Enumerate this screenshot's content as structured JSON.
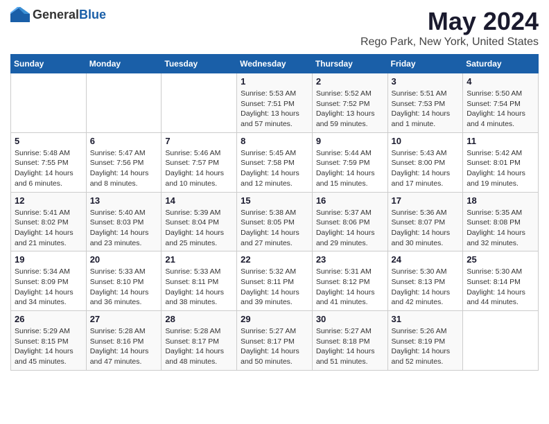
{
  "header": {
    "logo_general": "General",
    "logo_blue": "Blue",
    "title": "May 2024",
    "subtitle": "Rego Park, New York, United States"
  },
  "weekdays": [
    "Sunday",
    "Monday",
    "Tuesday",
    "Wednesday",
    "Thursday",
    "Friday",
    "Saturday"
  ],
  "weeks": [
    [
      {
        "day": "",
        "info": ""
      },
      {
        "day": "",
        "info": ""
      },
      {
        "day": "",
        "info": ""
      },
      {
        "day": "1",
        "info": "Sunrise: 5:53 AM\nSunset: 7:51 PM\nDaylight: 13 hours\nand 57 minutes."
      },
      {
        "day": "2",
        "info": "Sunrise: 5:52 AM\nSunset: 7:52 PM\nDaylight: 13 hours\nand 59 minutes."
      },
      {
        "day": "3",
        "info": "Sunrise: 5:51 AM\nSunset: 7:53 PM\nDaylight: 14 hours\nand 1 minute."
      },
      {
        "day": "4",
        "info": "Sunrise: 5:50 AM\nSunset: 7:54 PM\nDaylight: 14 hours\nand 4 minutes."
      }
    ],
    [
      {
        "day": "5",
        "info": "Sunrise: 5:48 AM\nSunset: 7:55 PM\nDaylight: 14 hours\nand 6 minutes."
      },
      {
        "day": "6",
        "info": "Sunrise: 5:47 AM\nSunset: 7:56 PM\nDaylight: 14 hours\nand 8 minutes."
      },
      {
        "day": "7",
        "info": "Sunrise: 5:46 AM\nSunset: 7:57 PM\nDaylight: 14 hours\nand 10 minutes."
      },
      {
        "day": "8",
        "info": "Sunrise: 5:45 AM\nSunset: 7:58 PM\nDaylight: 14 hours\nand 12 minutes."
      },
      {
        "day": "9",
        "info": "Sunrise: 5:44 AM\nSunset: 7:59 PM\nDaylight: 14 hours\nand 15 minutes."
      },
      {
        "day": "10",
        "info": "Sunrise: 5:43 AM\nSunset: 8:00 PM\nDaylight: 14 hours\nand 17 minutes."
      },
      {
        "day": "11",
        "info": "Sunrise: 5:42 AM\nSunset: 8:01 PM\nDaylight: 14 hours\nand 19 minutes."
      }
    ],
    [
      {
        "day": "12",
        "info": "Sunrise: 5:41 AM\nSunset: 8:02 PM\nDaylight: 14 hours\nand 21 minutes."
      },
      {
        "day": "13",
        "info": "Sunrise: 5:40 AM\nSunset: 8:03 PM\nDaylight: 14 hours\nand 23 minutes."
      },
      {
        "day": "14",
        "info": "Sunrise: 5:39 AM\nSunset: 8:04 PM\nDaylight: 14 hours\nand 25 minutes."
      },
      {
        "day": "15",
        "info": "Sunrise: 5:38 AM\nSunset: 8:05 PM\nDaylight: 14 hours\nand 27 minutes."
      },
      {
        "day": "16",
        "info": "Sunrise: 5:37 AM\nSunset: 8:06 PM\nDaylight: 14 hours\nand 29 minutes."
      },
      {
        "day": "17",
        "info": "Sunrise: 5:36 AM\nSunset: 8:07 PM\nDaylight: 14 hours\nand 30 minutes."
      },
      {
        "day": "18",
        "info": "Sunrise: 5:35 AM\nSunset: 8:08 PM\nDaylight: 14 hours\nand 32 minutes."
      }
    ],
    [
      {
        "day": "19",
        "info": "Sunrise: 5:34 AM\nSunset: 8:09 PM\nDaylight: 14 hours\nand 34 minutes."
      },
      {
        "day": "20",
        "info": "Sunrise: 5:33 AM\nSunset: 8:10 PM\nDaylight: 14 hours\nand 36 minutes."
      },
      {
        "day": "21",
        "info": "Sunrise: 5:33 AM\nSunset: 8:11 PM\nDaylight: 14 hours\nand 38 minutes."
      },
      {
        "day": "22",
        "info": "Sunrise: 5:32 AM\nSunset: 8:11 PM\nDaylight: 14 hours\nand 39 minutes."
      },
      {
        "day": "23",
        "info": "Sunrise: 5:31 AM\nSunset: 8:12 PM\nDaylight: 14 hours\nand 41 minutes."
      },
      {
        "day": "24",
        "info": "Sunrise: 5:30 AM\nSunset: 8:13 PM\nDaylight: 14 hours\nand 42 minutes."
      },
      {
        "day": "25",
        "info": "Sunrise: 5:30 AM\nSunset: 8:14 PM\nDaylight: 14 hours\nand 44 minutes."
      }
    ],
    [
      {
        "day": "26",
        "info": "Sunrise: 5:29 AM\nSunset: 8:15 PM\nDaylight: 14 hours\nand 45 minutes."
      },
      {
        "day": "27",
        "info": "Sunrise: 5:28 AM\nSunset: 8:16 PM\nDaylight: 14 hours\nand 47 minutes."
      },
      {
        "day": "28",
        "info": "Sunrise: 5:28 AM\nSunset: 8:17 PM\nDaylight: 14 hours\nand 48 minutes."
      },
      {
        "day": "29",
        "info": "Sunrise: 5:27 AM\nSunset: 8:17 PM\nDaylight: 14 hours\nand 50 minutes."
      },
      {
        "day": "30",
        "info": "Sunrise: 5:27 AM\nSunset: 8:18 PM\nDaylight: 14 hours\nand 51 minutes."
      },
      {
        "day": "31",
        "info": "Sunrise: 5:26 AM\nSunset: 8:19 PM\nDaylight: 14 hours\nand 52 minutes."
      },
      {
        "day": "",
        "info": ""
      }
    ]
  ]
}
